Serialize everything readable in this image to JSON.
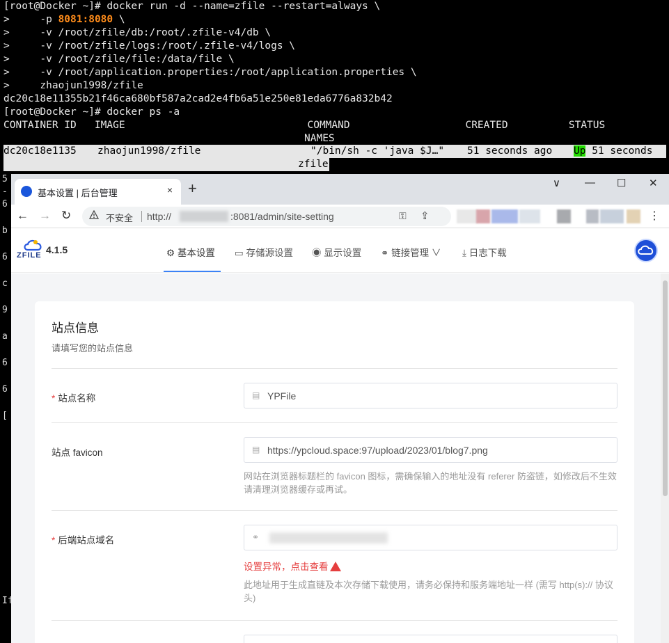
{
  "terminal": {
    "cmd1_prefix": "[root@Docker ~]# docker run -d --name=zfile --restart=always \\",
    "port_prefix": ">     -p ",
    "port_value": "8081:8080",
    "port_suffix": " \\",
    "line_db": ">     -v /root/zfile/db:/root/.zfile-v4/db \\",
    "line_logs": ">     -v /root/zfile/logs:/root/.zfile-v4/logs \\",
    "line_file": ">     -v /root/zfile/file:/data/file \\",
    "line_props": ">     -v /root/application.properties:/root/application.properties \\",
    "line_image": ">     zhaojun1998/zfile",
    "container_hash": "dc20c18e11355b21f46ca680bf587a2cad2e4fb6a51e250e81eda6776a832b42",
    "cmd2": "[root@Docker ~]# docker ps -a",
    "ps_header": "CONTAINER ID   IMAGE                              COMMAND                   CREATED          STATUS",
    "ps_header2": "NAMES",
    "row_id": "dc20c18e1135",
    "row_image": "zhaojun1998/zfile",
    "row_command": "\"/bin/sh -c 'java $J…\"",
    "row_created": "51 seconds ago",
    "row_status_up": "Up",
    "row_status_rest": " 51 seconds",
    "row_name": "zfile",
    "left_margin_chars": [
      "5",
      "-",
      "6",
      "b",
      "6",
      "c",
      "9",
      "a",
      "6",
      "6",
      "[",
      "If"
    ]
  },
  "browser": {
    "tab_title": "基本设置 | 后台管理",
    "tab_close": "×",
    "new_tab": "+",
    "window_minimize": "∨",
    "window_min": "—",
    "window_max": "☐",
    "window_close": "✕",
    "back": "←",
    "forward": "→",
    "reload": "↻",
    "insecure_label": "不安全",
    "url_scheme": "http://",
    "url_rest": ":8081/admin/site-setting",
    "key_icon": "⚿",
    "share_icon": "⇪",
    "menu_icon": "⋮"
  },
  "app": {
    "logo_text": "ZFILE",
    "version": "4.1.5",
    "nav": [
      {
        "icon": "⚙",
        "label": "基本设置"
      },
      {
        "icon": "▭",
        "label": "存储源设置"
      },
      {
        "icon": "◉",
        "label": "显示设置"
      },
      {
        "icon": "⚭",
        "label": "链接管理"
      },
      {
        "icon": "⤓",
        "label": "日志下载"
      }
    ],
    "nav_chevron": "∨"
  },
  "form": {
    "title": "站点信息",
    "subtitle": "请填写您的站点信息",
    "site_name_label": "站点名称",
    "site_name_value": "YPFile",
    "favicon_label": "站点 favicon",
    "favicon_value": "https://ypcloud.space:97/upload/2023/01/blog7.png",
    "favicon_hint": "网站在浏览器标题栏的 favicon 图标，需确保输入的地址没有 referer 防盗链，如修改后不生效请清理浏览器缓存或再试。",
    "domain_label": "后端站点域名",
    "domain_error": "设置异常，点击查看",
    "domain_hint": "此地址用于生成直链及本次存储下载使用，请务必保持和服务端地址一样 (需写 http(s):// 协议头)",
    "required_mark": "*",
    "doc_icon": "▤",
    "link_icon": "⚭"
  },
  "colors": {
    "accent": "#3b82f6",
    "error": "#e53e3e",
    "terminal_port": "#ff8c1a",
    "status_up": "#22dd00"
  }
}
